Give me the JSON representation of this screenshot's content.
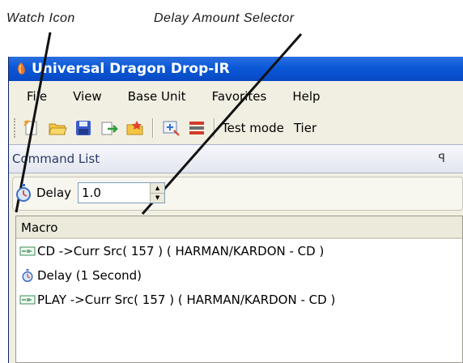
{
  "callouts": {
    "watch_icon": "Watch Icon",
    "delay_selector": "Delay Amount Selector"
  },
  "window": {
    "title": "Universal Dragon Drop-IR"
  },
  "menu": [
    "File",
    "View",
    "Base Unit",
    "Favorites",
    "Help"
  ],
  "toolbar": {
    "test_mode": "Test mode",
    "tier": "Tier"
  },
  "command_list": {
    "title": "Command List",
    "pin": "ꟼ"
  },
  "delay": {
    "label": "Delay",
    "value": "1.0"
  },
  "list": {
    "header": "Macro",
    "rows": [
      {
        "icon": "ir-remote-icon",
        "text": "CD ->Curr Src( 157 ) ( HARMAN/KARDON - CD )"
      },
      {
        "icon": "stopwatch-icon",
        "text": "Delay (1 Second)"
      },
      {
        "icon": "ir-remote-icon",
        "text": "PLAY ->Curr Src( 157 ) ( HARMAN/KARDON - CD )"
      }
    ]
  },
  "colors": {
    "titlebar": "#0a58d8",
    "window_bg": "#f1efe2",
    "accent": "#2b3a66"
  }
}
